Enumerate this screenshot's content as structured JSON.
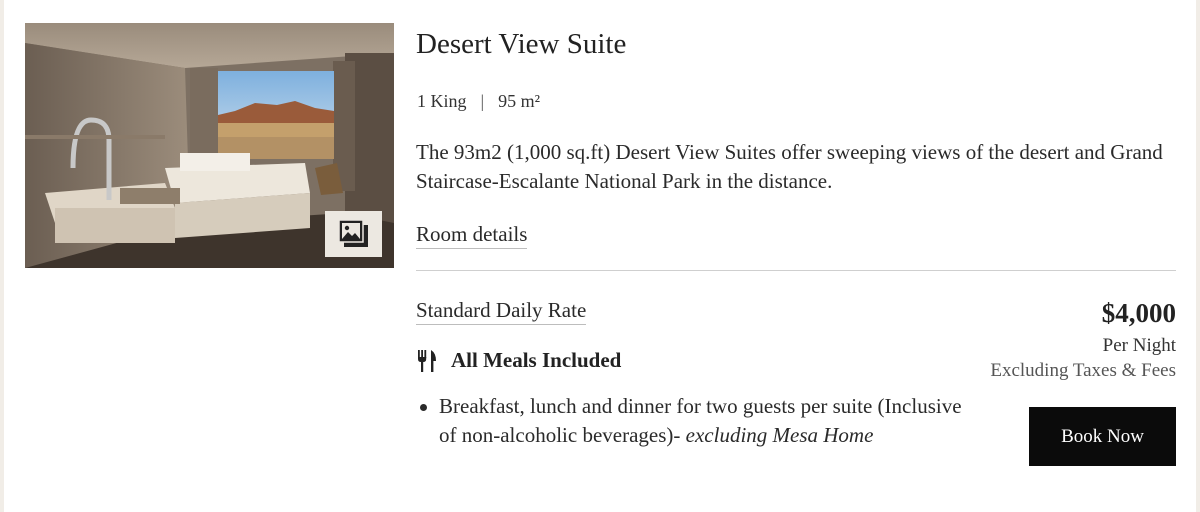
{
  "room": {
    "title": "Desert View Suite",
    "bed": "1 King",
    "separator": "|",
    "size": "95 m²",
    "description": "The 93m2 (1,000 sq.ft) Desert View Suites offer sweeping views of the desert and Grand Staircase-Escalante National Park in the distance.",
    "details_link": "Room details"
  },
  "rate": {
    "name": "Standard Daily Rate",
    "meal_plan": "All Meals Included",
    "inclusion_text": "Breakfast, lunch and dinner for two guests per suite (Inclusive of non-alcoholic beverages)- ",
    "inclusion_italic": "excluding Mesa Home",
    "price": "$4,000",
    "per_night": "Per Night",
    "taxes_note": "Excluding Taxes & Fees",
    "book_label": "Book Now"
  },
  "icons": {
    "gallery": "image-gallery-icon",
    "meals": "fork-knife-icon"
  },
  "colors": {
    "book_button_bg": "#0b0b0b",
    "book_button_text": "#ffffff",
    "gallery_button_bg": "#ece8e1",
    "divider": "#cfcfcf"
  }
}
